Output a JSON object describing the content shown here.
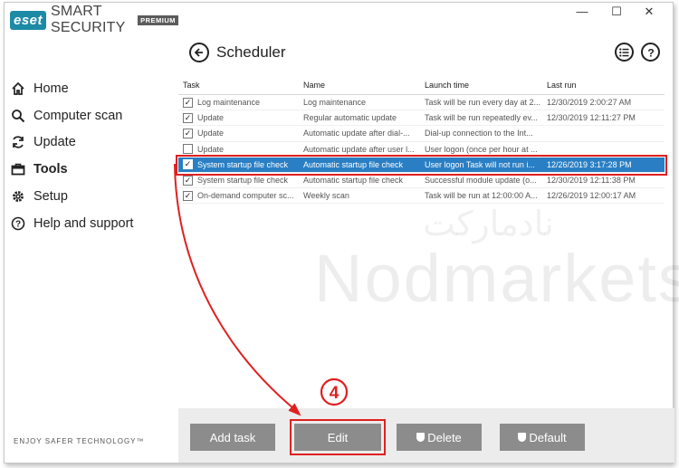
{
  "app": {
    "logo": "eset",
    "name": "SMART SECURITY",
    "edition": "PREMIUM",
    "tagline": "ENJOY SAFER TECHNOLOGY™"
  },
  "window_controls": {
    "minimize": "—",
    "maximize": "☐",
    "close": "✕"
  },
  "sidebar": {
    "items": [
      {
        "label": "Home",
        "icon": "home-icon"
      },
      {
        "label": "Computer scan",
        "icon": "search-icon"
      },
      {
        "label": "Update",
        "icon": "refresh-icon"
      },
      {
        "label": "Tools",
        "icon": "briefcase-icon",
        "active": true
      },
      {
        "label": "Setup",
        "icon": "gear-icon"
      },
      {
        "label": "Help and support",
        "icon": "help-icon"
      }
    ]
  },
  "page": {
    "title": "Scheduler"
  },
  "table": {
    "headers": [
      "Task",
      "Name",
      "Launch time",
      "Last run"
    ],
    "rows": [
      {
        "checked": true,
        "task": "Log maintenance",
        "name": "Log maintenance",
        "launch": "Task will be run every day at 2...",
        "last": "12/30/2019 2:00:27 AM"
      },
      {
        "checked": true,
        "task": "Update",
        "name": "Regular automatic update",
        "launch": "Task will be run repeatedly ev...",
        "last": "12/30/2019 12:11:27 PM"
      },
      {
        "checked": true,
        "task": "Update",
        "name": "Automatic update after dial-...",
        "launch": "Dial-up connection to the Int...",
        "last": ""
      },
      {
        "checked": false,
        "task": "Update",
        "name": "Automatic update after user l...",
        "launch": "User logon (once per hour at ...",
        "last": ""
      },
      {
        "checked": true,
        "task": "System startup file check",
        "name": "Automatic startup file check",
        "launch": "User logon Task will not run i...",
        "last": "12/26/2019 3:17:28 PM",
        "selected": true
      },
      {
        "checked": true,
        "task": "System startup file check",
        "name": "Automatic startup file check",
        "launch": "Successful module update (o...",
        "last": "12/30/2019 12:11:38 PM"
      },
      {
        "checked": true,
        "task": "On-demand computer sc...",
        "name": "Weekly scan",
        "launch": "Task will be run at 12:00:00 A...",
        "last": "12/26/2019 12:00:17 AM"
      }
    ]
  },
  "watermark": {
    "arabic": "نادمارکت",
    "latin": "Nodmarkets"
  },
  "annotation": {
    "step": "4"
  },
  "buttons": {
    "add_task": "Add task",
    "edit": "Edit",
    "delete": "Delete",
    "default": "Default"
  },
  "colors": {
    "accent": "#2a7fc4",
    "highlight": "#e02020",
    "button": "#8c8c8c",
    "brand": "#1d8aa6"
  }
}
